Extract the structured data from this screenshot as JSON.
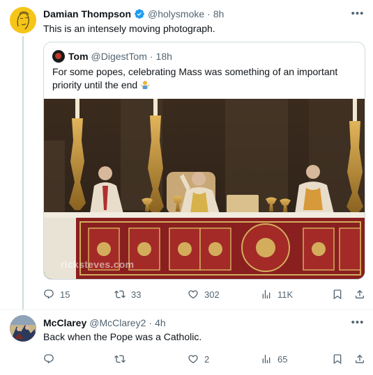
{
  "main_tweet": {
    "name": "Damian Thompson",
    "handle": "@holysmoke",
    "time": "8h",
    "text": "This is an intensely moving photograph.",
    "quote": {
      "name": "Tom",
      "handle": "@DigestTom",
      "time": "18h",
      "text": "For some popes, celebrating Mass was something of an important priority until the end",
      "emoji": "person-shrugging-emoji",
      "media_watermark": "ricksteves.com"
    },
    "actions": {
      "replies": "15",
      "reposts": "33",
      "likes": "302",
      "views": "11K"
    }
  },
  "reply_tweet": {
    "name": "McClarey",
    "handle": "@McClarey2",
    "time": "4h",
    "text": "Back when the Pope was a Catholic.",
    "actions": {
      "replies": "",
      "reposts": "",
      "likes": "2",
      "views": "65"
    }
  },
  "colors": {
    "text_primary": "#0f1419",
    "text_secondary": "#536471",
    "border": "#cfd9de",
    "verified_blue": "#1d9bf0"
  },
  "icons": [
    "reply-icon",
    "repost-icon",
    "like-icon",
    "views-icon",
    "bookmark-icon",
    "share-icon",
    "more-icon",
    "verified-icon"
  ]
}
